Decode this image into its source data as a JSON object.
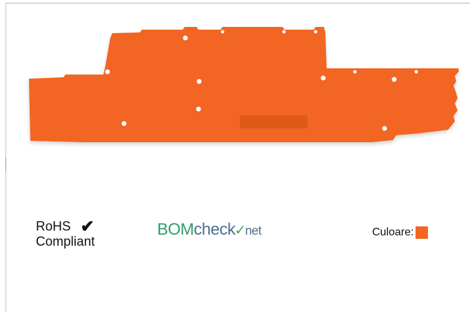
{
  "rohs": {
    "line1": "RoHS",
    "line2": "Compliant",
    "check_icon": "checkmark-icon"
  },
  "bomcheck": {
    "part1": "BOM",
    "part2": "check",
    "part3": "net",
    "tick_icon": "checkmark-icon"
  },
  "color": {
    "label": "Culoare:",
    "swatch_hex": "#f26522"
  },
  "product": {
    "fill_hex": "#f26522",
    "engraving_hex": "#de5a18"
  }
}
